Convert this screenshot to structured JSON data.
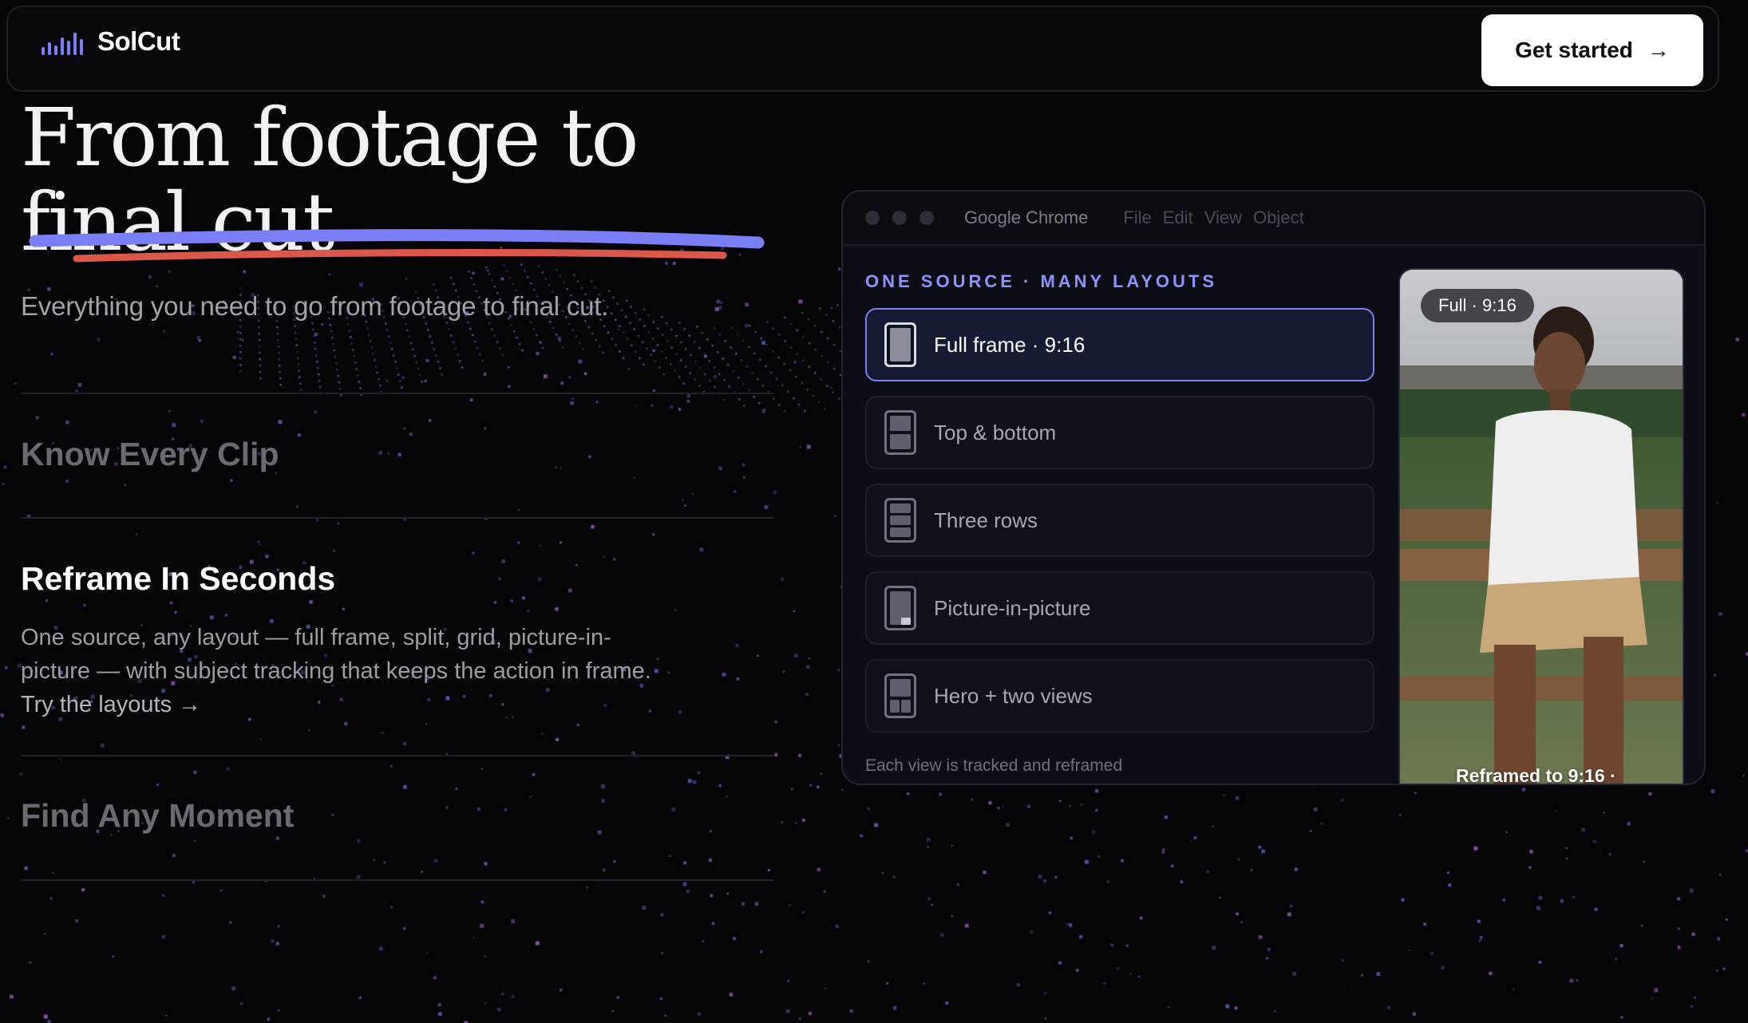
{
  "brand": {
    "name": "SolCut"
  },
  "nav": {
    "cta_label": "Get started",
    "cta_icon": "arrow-right-icon"
  },
  "hero": {
    "title_line1": "From footage to",
    "title_line2": "final cut",
    "subtitle": "Everything you need to go from footage to final cut."
  },
  "features": {
    "item1_title": "Know Every Clip",
    "item2_title": "Reframe In Seconds",
    "item2_desc": "One source, any layout — full frame, split, grid, picture-in-picture — with subject tracking that keeps the action in frame.",
    "item2_link": "Try the layouts →",
    "item3_title": "Find Any Moment"
  },
  "browser": {
    "app_name": "Google Chrome",
    "menu": [
      "File",
      "Edit",
      "View",
      "Object"
    ],
    "panel_label": "ONE SOURCE · MANY LAYOUTS",
    "options": [
      {
        "label": "Full frame · 9:16",
        "icon": "full-frame-layout-icon",
        "selected": true
      },
      {
        "label": "Top & bottom",
        "icon": "top-bottom-layout-icon",
        "selected": false
      },
      {
        "label": "Three rows",
        "icon": "three-rows-layout-icon",
        "selected": false
      },
      {
        "label": "Picture-in-picture",
        "icon": "pip-layout-icon",
        "selected": false
      },
      {
        "label": "Hero + two views",
        "icon": "hero-two-views-layout-icon",
        "selected": false
      }
    ],
    "footer": "Each view is tracked and reframed",
    "preview": {
      "badge": "Full · 9:16",
      "caption": "Reframed to 9:16 ·"
    }
  },
  "colors": {
    "accent": "#7b7ff5",
    "accent_red": "#d9584a",
    "bg": "#050508"
  }
}
